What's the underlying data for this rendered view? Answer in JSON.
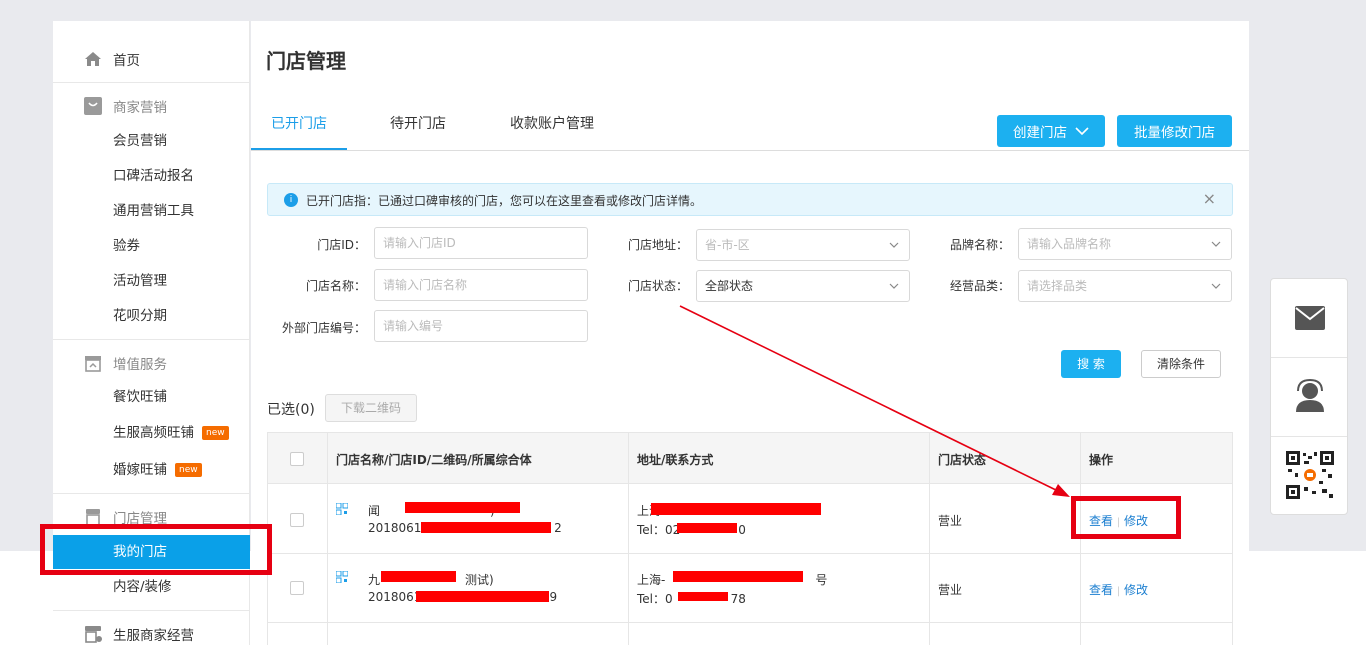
{
  "sidebar": {
    "home": "首页",
    "group_marketing": "商家营销",
    "marketing_items": [
      "会员营销",
      "口碑活动报名",
      "通用营销工具",
      "验券",
      "活动管理",
      "花呗分期"
    ],
    "group_value_added": "增值服务",
    "value_added_items": [
      "餐饮旺铺",
      "生服高频旺铺",
      "婚嫁旺铺"
    ],
    "new_badge": "new",
    "group_store": "门店管理",
    "store_items": [
      "我的门店",
      "内容/装修"
    ],
    "group_local_services": "生服商家经营"
  },
  "header": {
    "title": "门店管理",
    "tabs": [
      "已开门店",
      "待开门店",
      "收款账户管理"
    ],
    "create_store": "创建门店",
    "batch_edit": "批量修改门店"
  },
  "notice": {
    "text": "已开门店指：已通过口碑审核的门店，您可以在这里查看或修改门店详情。",
    "info_icon": "i",
    "close_icon": "×"
  },
  "filters": {
    "store_id_label": "门店ID：",
    "store_id_placeholder": "请输入门店ID",
    "address_label": "门店地址：",
    "address_placeholder": "省-市-区",
    "brand_label": "品牌名称：",
    "brand_placeholder": "请输入品牌名称",
    "store_name_label": "门店名称：",
    "store_name_placeholder": "请输入门店名称",
    "status_label": "门店状态：",
    "status_value": "全部状态",
    "category_label": "经营品类：",
    "category_placeholder": "请选择品类",
    "external_label": "外部门店编号：",
    "external_placeholder": "请输入编号",
    "search": "搜 索",
    "clear": "清除条件"
  },
  "selection": {
    "count": "已选(0)",
    "download_qr": "下载二维码"
  },
  "table": {
    "headers": [
      "门店名称/门店ID/二维码/所属综合体",
      "地址/联系方式",
      "门店状态",
      "操作"
    ],
    "rows": [
      {
        "name": "闻",
        "name_suffix": ")",
        "id": "20180614",
        "id_suffix": "2",
        "address": "上海",
        "tel_prefix": "Tel：02",
        "tel_suffix": "0",
        "status": "营业",
        "view": "查看",
        "divider": "|",
        "edit": "修改"
      },
      {
        "name": "九",
        "name_suffix": "测试)",
        "id": "2018061",
        "id_suffix": "9",
        "address": "上海-",
        "address_suffix": "号",
        "tel_prefix": "Tel：0",
        "tel_suffix": "78",
        "status": "营业",
        "view": "查看",
        "divider": "|",
        "edit": "修改"
      }
    ]
  },
  "colors": {
    "accent": "#1cb0f0",
    "active_nav": "#0aa0e8",
    "annotation_red": "#e60012"
  }
}
